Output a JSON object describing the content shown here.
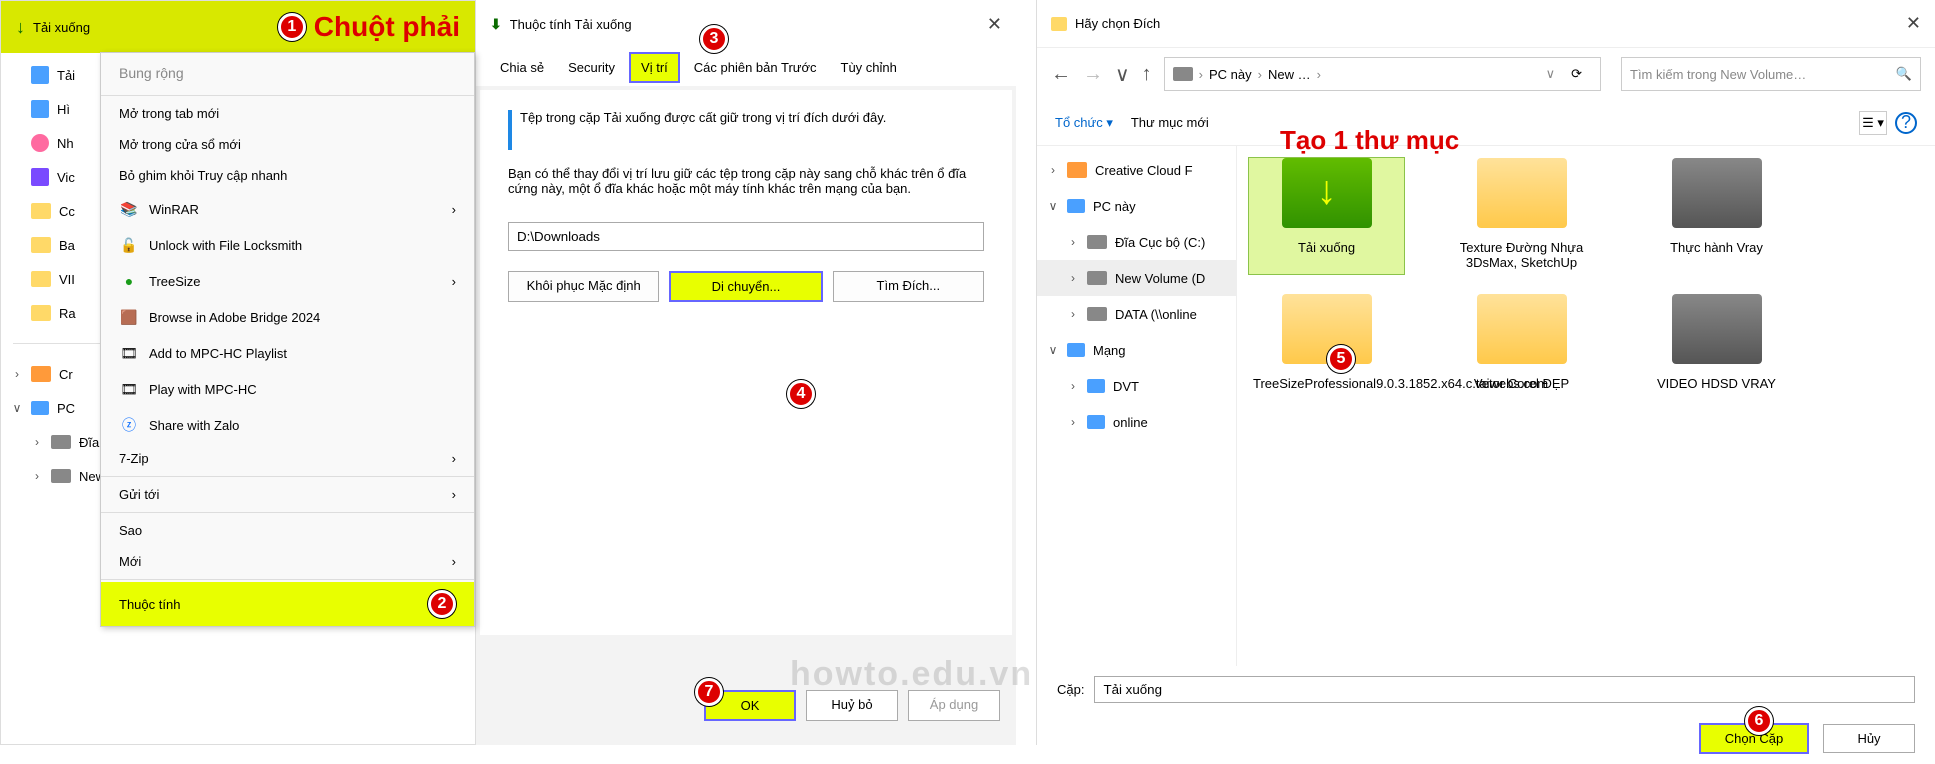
{
  "panel1": {
    "header": "Tải xuống",
    "marker1": "1",
    "annotation_right_click": "Chuột phải",
    "tree_items": [
      {
        "label": "Tải",
        "icon": "doc"
      },
      {
        "label": "Hì",
        "icon": "img"
      },
      {
        "label": "Nh",
        "icon": "music"
      },
      {
        "label": "Vic",
        "icon": "video"
      },
      {
        "label": "Cc",
        "icon": "folder"
      },
      {
        "label": "Ba",
        "icon": "folder"
      },
      {
        "label": "VII",
        "icon": "folder"
      },
      {
        "label": "Ra",
        "icon": "folder"
      }
    ],
    "tree2": [
      {
        "label": "Cr",
        "icon": "cloud"
      },
      {
        "label": "PC",
        "icon": "pc",
        "expanded": true
      },
      {
        "label": "Đĩa Cục bộ (C:)",
        "icon": "hd"
      },
      {
        "label": "New Volume (D:)",
        "icon": "hd"
      }
    ]
  },
  "context_menu": {
    "title": "Bung rộng",
    "items1": [
      {
        "label": "Mở trong tab mới"
      },
      {
        "label": "Mở trong cửa sổ mới"
      },
      {
        "label": "Bỏ ghim khỏi Truy cập nhanh"
      },
      {
        "label": "WinRAR",
        "icon": "winrar",
        "arrow": true
      },
      {
        "label": "Unlock with File Locksmith",
        "icon": "lock"
      },
      {
        "label": "TreeSize",
        "icon": "tree",
        "arrow": true
      },
      {
        "label": "Browse in Adobe Bridge 2024",
        "icon": "bridge"
      },
      {
        "label": "Add to MPC-HC Playlist",
        "icon": "mpc"
      },
      {
        "label": "Play with MPC-HC",
        "icon": "mpc2"
      },
      {
        "label": "Share with Zalo",
        "icon": "zalo"
      },
      {
        "label": "7-Zip",
        "arrow": true
      }
    ],
    "items2": [
      {
        "label": "Gửi tới",
        "arrow": true
      }
    ],
    "items3": [
      {
        "label": "Sao"
      },
      {
        "label": "Mới",
        "arrow": true
      }
    ],
    "items4": [
      {
        "label": "Thuộc tính",
        "highlight": true,
        "marker": "2"
      }
    ]
  },
  "properties": {
    "title": "Thuộc tính Tải xuống",
    "tabs": [
      "Chia sẻ",
      "Security",
      "Vị trí",
      "Các phiên bản Trước",
      "Tùy chỉnh"
    ],
    "active_tab_index": 2,
    "desc1": "Tệp trong cặp Tải xuống được cất giữ trong vị trí đích dưới đây.",
    "desc2": "Bạn có thể thay đổi vị trí lưu giữ các tệp trong cặp này sang chỗ khác trên ổ đĩa cứng này, một ổ đĩa khác hoặc một máy tính khác trên mạng của bạn.",
    "path": "D:\\Downloads",
    "btn_restore": "Khôi phục Mặc định",
    "btn_move": "Di chuyển...",
    "btn_find": "Tìm Đích...",
    "btn_ok": "OK",
    "btn_cancel": "Huỷ bỏ",
    "btn_apply": "Áp dụng"
  },
  "picker": {
    "title": "Hãy chọn Đích",
    "nav_back": "←",
    "nav_fwd": "→",
    "breadcrumb": [
      "PC này",
      "New …"
    ],
    "search_placeholder": "Tìm kiếm trong New Volume…",
    "toolbar_organize": "Tổ chức",
    "toolbar_new_folder": "Thư mục mới",
    "annotation_create": "Tạo 1 thư mục",
    "tree": [
      {
        "label": "Creative Cloud F",
        "icon": "cloud",
        "exp": ">"
      },
      {
        "label": "PC này",
        "icon": "pc",
        "exp": "∨"
      },
      {
        "label": "Đĩa Cục bộ (C:)",
        "icon": "hd",
        "exp": ">",
        "indent": 1
      },
      {
        "label": "New Volume (D",
        "icon": "hd",
        "exp": ">",
        "indent": 1,
        "selected": true
      },
      {
        "label": "DATA (\\\\online",
        "icon": "hd",
        "exp": ">",
        "indent": 1
      },
      {
        "label": "Mạng",
        "icon": "net",
        "exp": "∨"
      },
      {
        "label": "DVT",
        "icon": "pc",
        "exp": ">",
        "indent": 1
      },
      {
        "label": "online",
        "icon": "pc",
        "exp": ">",
        "indent": 1
      }
    ],
    "folders": [
      {
        "label": "Tải xuống",
        "green": true,
        "selected": true
      },
      {
        "label": "Texture Đường Nhựa 3DsMax, SketchUp"
      },
      {
        "label": "Thực hành Vray"
      },
      {
        "label": "TreeSizeProfessional9.0.3.1852.x64.c.taiwebs.com"
      },
      {
        "label": "Vetor Corel ĐẸP"
      },
      {
        "label": "VIDEO HDSD VRAY"
      }
    ],
    "folder_label": "Cặp:",
    "folder_value": "Tải xuống",
    "btn_choose": "Chọn Cặp",
    "btn_cancel": "Hủy"
  },
  "markers": {
    "m3": "3",
    "m4": "4",
    "m5": "5",
    "m6": "6",
    "m7": "7"
  },
  "watermark": "howto.edu.vn"
}
